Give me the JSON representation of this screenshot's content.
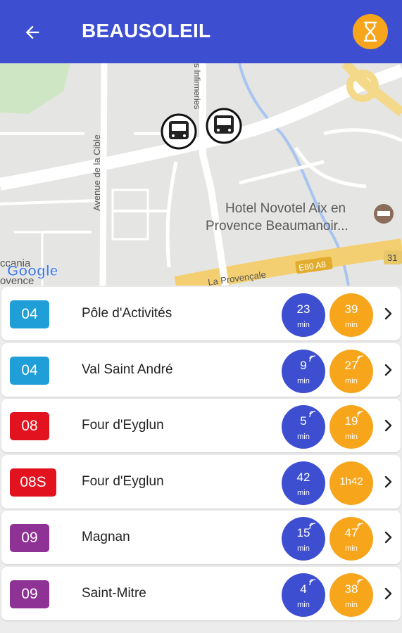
{
  "header": {
    "title": "BEAUSOLEIL",
    "back_icon": "arrow-left-icon",
    "timer_icon": "hourglass-icon",
    "bar_color": "#3d4fd0",
    "accent_color": "#f7a51b"
  },
  "map": {
    "labels": {
      "street1": "Avenue de la Cible",
      "street2": "s Infirmeries",
      "hotel_line1": "Hotel Novotel Aix en",
      "hotel_line2": "Provence Beaumanoir...",
      "highway": "La Provençale",
      "highway_badge": "E80 A8",
      "exit_badge": "31",
      "place_left1": "ccania",
      "place_left2": "ovence",
      "google": "Google"
    },
    "markers": [
      "bus-stop-icon",
      "bus-stop-icon"
    ]
  },
  "departures": [
    {
      "line": "04",
      "color": "#1f9ed8",
      "destination": "Pôle d'Activités",
      "next": "23",
      "next_unit": "min",
      "next_realtime": false,
      "after": "39",
      "after_unit": "min",
      "after_realtime": false
    },
    {
      "line": "04",
      "color": "#1f9ed8",
      "destination": "Val Saint André",
      "next": "9",
      "next_unit": "min",
      "next_realtime": true,
      "after": "27",
      "after_unit": "min",
      "after_realtime": true
    },
    {
      "line": "08",
      "color": "#e3121f",
      "destination": "Four d'Eyglun",
      "next": "5",
      "next_unit": "min",
      "next_realtime": true,
      "after": "19",
      "after_unit": "min",
      "after_realtime": true
    },
    {
      "line": "08S",
      "color": "#e3121f",
      "destination": "Four d'Eyglun",
      "next": "42",
      "next_unit": "min",
      "next_realtime": false,
      "after": "1h42",
      "after_unit": "",
      "after_realtime": false
    },
    {
      "line": "09",
      "color": "#8e3296",
      "destination": "Magnan",
      "next": "15",
      "next_unit": "min",
      "next_realtime": true,
      "after": "47",
      "after_unit": "min",
      "after_realtime": true
    },
    {
      "line": "09",
      "color": "#8e3296",
      "destination": "Saint-Mitre",
      "next": "4",
      "next_unit": "min",
      "next_realtime": true,
      "after": "38",
      "after_unit": "min",
      "after_realtime": true
    }
  ]
}
